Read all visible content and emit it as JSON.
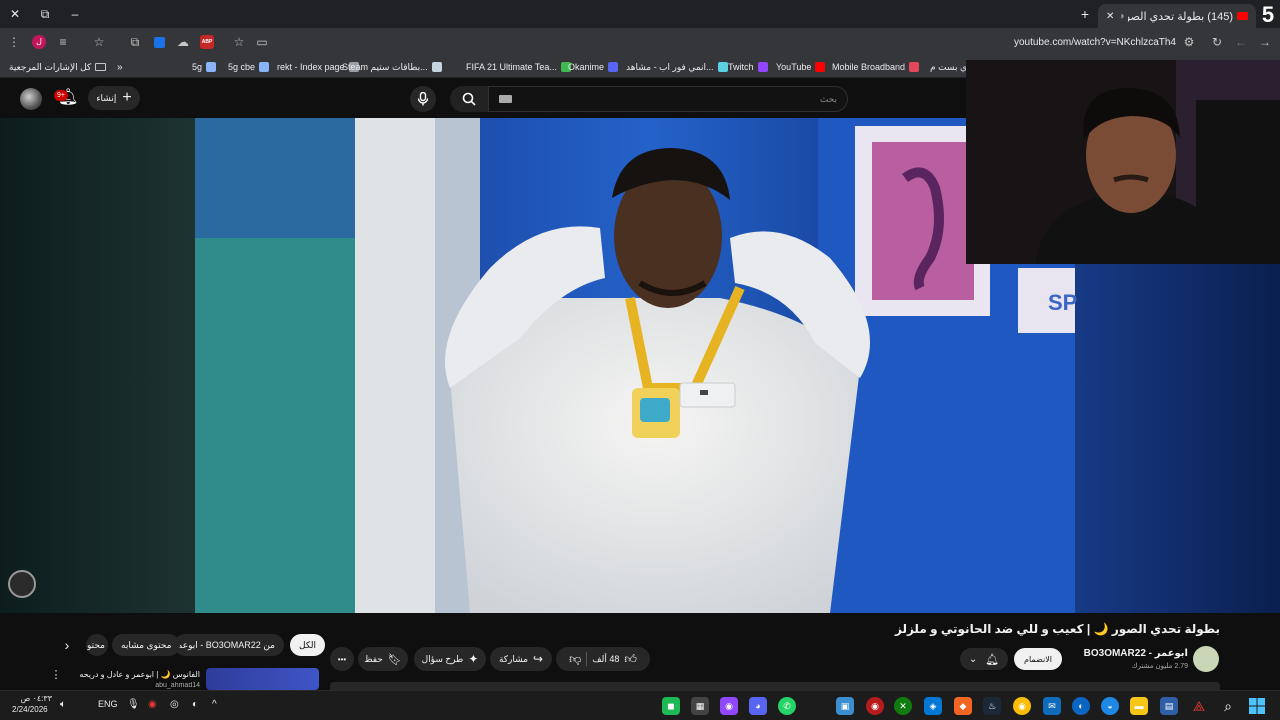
{
  "badge": "5",
  "browser": {
    "tab_title": "(145) بطولة تحدي الصور 🌙",
    "tab_close": "✕",
    "new_tab": "+",
    "url": "youtube.com/watch?v=NKchlzcaTh4",
    "ext_letter": "ل",
    "abp": "ABP",
    "win_minimize": "–",
    "win_restore": "⧉",
    "win_close": "✕"
  },
  "bookmarks": {
    "all_bookmarks": "كل الإشارات المرجعية",
    "items": [
      {
        "label": "5g",
        "color": "#8ab4f8"
      },
      {
        "label": "5g cbe",
        "color": "#8ab4f8"
      },
      {
        "label": "rekt - Index page",
        "color": "#9aa0a6"
      },
      {
        "label": "Steam بطاقات ستيم...",
        "color": "#c6d4df"
      },
      {
        "label": "FIFA 21 Ultimate Tea...",
        "color": "#3fb950"
      },
      {
        "label": "Okanime",
        "color": "#5865f2"
      },
      {
        "label": "انمي فور اب - مشاهد...",
        "color": "#5ad1e0"
      },
      {
        "label": "Twitch",
        "color": "#9146ff"
      },
      {
        "label": "YouTube",
        "color": "#ff0000"
      },
      {
        "label": "Mobile Broadband",
        "color": "#e3475b"
      },
      {
        "label": "ي بست م...",
        "color": "#ffffff"
      }
    ]
  },
  "yt": {
    "search_placeholder": "بحث",
    "create_label": "إنشاء",
    "notif_count": "9+",
    "title": "بطولة تحدي الصور 🌙 | كعيب و للي ضد الحانوتي و ملزلز",
    "channel_name": "ابوعمر - BO3OMAR22",
    "subscribers": "2.79 مليون مشترك",
    "join_label": "الانضمام",
    "likes": "48 ألف",
    "share_label": "مشاركة",
    "ask_label": "طرح سؤال",
    "save_label": "حفظ",
    "more_label": "•••",
    "chips": [
      "الكل",
      "من BO3OMAR22 - ابوعمر",
      "محتوى مشابه",
      "محتو"
    ],
    "rec_title": "الفانوس 🌙 | ابوعمر و عادل و دريحه",
    "rec_channel": "abu_ahmad14"
  },
  "taskbar": {
    "lang": "ENG",
    "time": "٠٤:٣٣ ص",
    "date": "2/24/2026",
    "chevron": "^"
  },
  "colors": {
    "yt_red": "#ff0000",
    "accent_blue": "#8ab4f8"
  }
}
